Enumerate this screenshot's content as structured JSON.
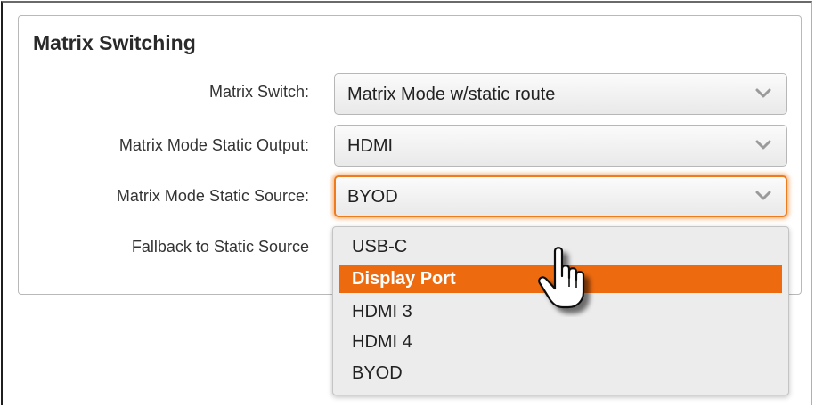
{
  "panel": {
    "title": "Matrix Switching"
  },
  "rows": [
    {
      "label": "Matrix Switch:",
      "value": "Matrix Mode w/static route"
    },
    {
      "label": "Matrix Mode Static Output:",
      "value": "HDMI"
    },
    {
      "label": "Matrix Mode Static Source:",
      "value": "BYOD"
    },
    {
      "label": "Fallback to Static Source"
    }
  ],
  "dropdown": {
    "options": [
      "USB-C",
      "Display Port",
      "HDMI 3",
      "HDMI 4",
      "BYOD"
    ],
    "highlighted": "Display Port"
  },
  "colors": {
    "accent": "#ee6a0f",
    "focus_border": "#f07b1c"
  },
  "icons": {
    "chevron": "chevron-down-icon",
    "cursor": "hand-pointer-cursor-icon"
  }
}
